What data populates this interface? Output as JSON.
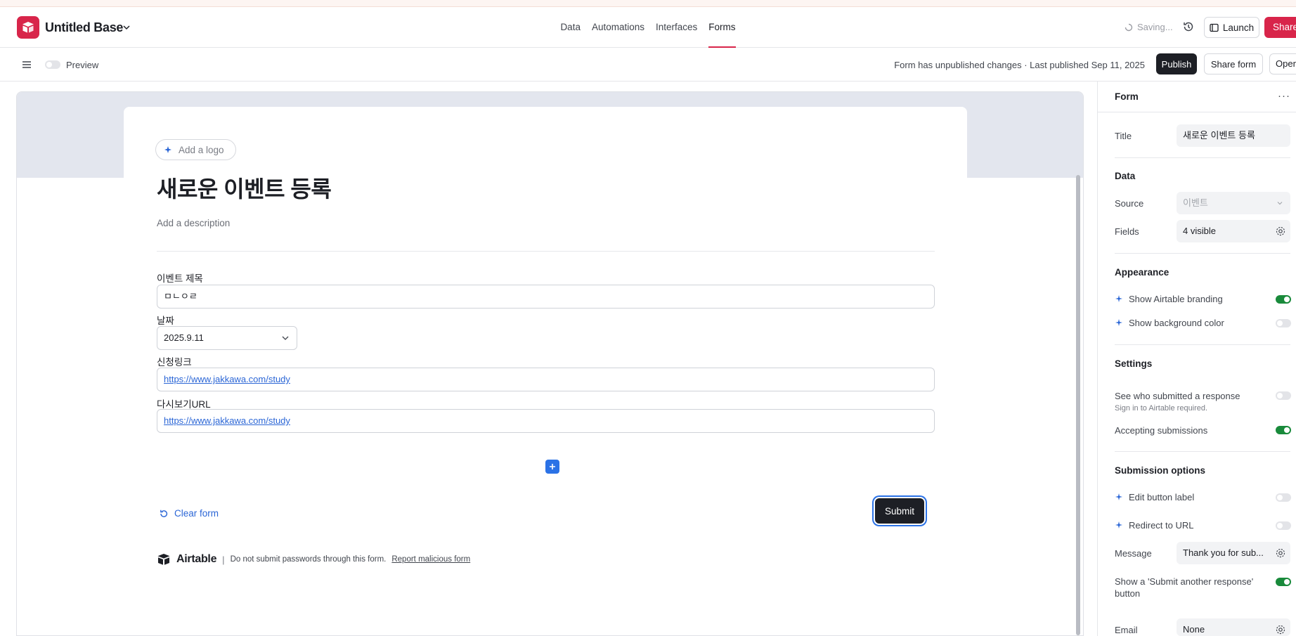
{
  "header": {
    "base_name": "Untitled Base",
    "tabs": [
      "Data",
      "Automations",
      "Interfaces",
      "Forms"
    ],
    "active_tab": "Forms",
    "saving": "Saving...",
    "launch": "Launch",
    "share": "Share"
  },
  "toolbar": {
    "preview": "Preview",
    "status": "Form has unpublished changes · Last published Sep 11, 2025",
    "publish": "Publish",
    "share_form": "Share form",
    "open": "Open"
  },
  "form": {
    "add_logo": "Add a logo",
    "title": "새로운 이벤트 등록",
    "description_placeholder": "Add a description",
    "fields": [
      {
        "label": "이벤트 제목",
        "value": "ㅁㄴㅇㄹ"
      },
      {
        "label": "날짜",
        "value": "2025.9.11"
      },
      {
        "label": "신청링크",
        "value": "https://www.jakkawa.com/study"
      },
      {
        "label": "다시보기URL",
        "value": "https://www.jakkawa.com/study"
      }
    ],
    "clear_form": "Clear form",
    "submit": "Submit",
    "footer": {
      "brand": "Airtable",
      "separator": "|",
      "notice": "Do not submit passwords through this form.",
      "report": "Report malicious form"
    }
  },
  "panel": {
    "title": "Form",
    "more": "···",
    "title_label": "Title",
    "title_value": "새로운 이벤트 등록",
    "data_heading": "Data",
    "source_label": "Source",
    "source_value": "이벤트",
    "fields_label": "Fields",
    "fields_value": "4 visible",
    "appearance_heading": "Appearance",
    "show_branding": "Show Airtable branding",
    "show_bg_color": "Show background color",
    "settings_heading": "Settings",
    "see_who": "See who submitted a response",
    "see_who_sub": "Sign in to Airtable required.",
    "accepting": "Accepting submissions",
    "submission_heading": "Submission options",
    "edit_button_label": "Edit button label",
    "redirect": "Redirect to URL",
    "message_label": "Message",
    "message_value": "Thank you for sub...",
    "submit_another": "Show a 'Submit another response' button",
    "email_label": "Email",
    "email_value": "None",
    "toggles": {
      "show_branding": true,
      "show_bg_color": false,
      "see_who": false,
      "accepting": true,
      "edit_button_label": false,
      "redirect": false,
      "submit_another": true
    }
  },
  "colors": {
    "brand": "#d8254a",
    "link": "#2b66d6",
    "toggle_on": "#198a3b",
    "dark_button": "#1d1f25"
  }
}
